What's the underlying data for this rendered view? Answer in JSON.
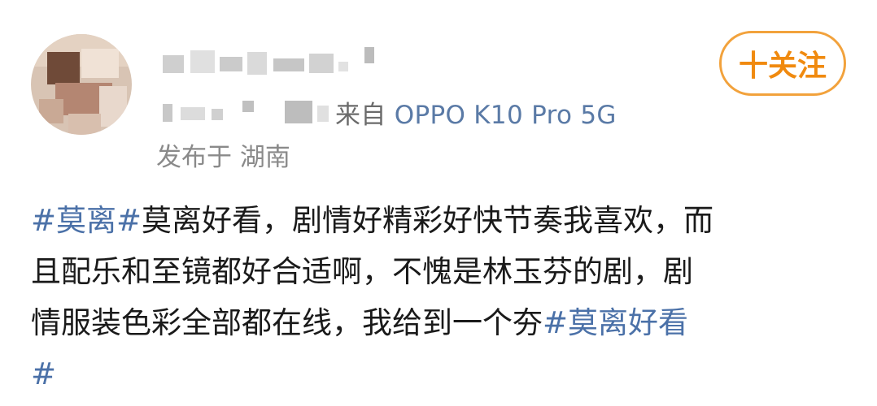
{
  "author": {
    "name_obscured": true,
    "avatar_obscured": true
  },
  "meta": {
    "source_prefix": "来自",
    "device": "OPPO K10 Pro 5G",
    "location": "发布于 湖南"
  },
  "follow_button": {
    "label": "十关注"
  },
  "post": {
    "lines": [
      [
        {
          "text": "#莫离#",
          "tag": true
        },
        {
          "text": "莫离好看，剧情好精彩好快节奏我喜欢，而",
          "tag": false
        }
      ],
      [
        {
          "text": "且配乐和至镜都好合适啊，不愧是林玉芬的剧，剧",
          "tag": false
        }
      ],
      [
        {
          "text": "情服装色彩全部都在线，我给到一个夯",
          "tag": false
        },
        {
          "text": "#莫离好看",
          "tag": true
        }
      ],
      [
        {
          "text": "#",
          "tag": true
        }
      ]
    ]
  },
  "colors": {
    "tag": "#4b71a8",
    "accent": "#f08a0f",
    "device": "#5a7aa6"
  }
}
